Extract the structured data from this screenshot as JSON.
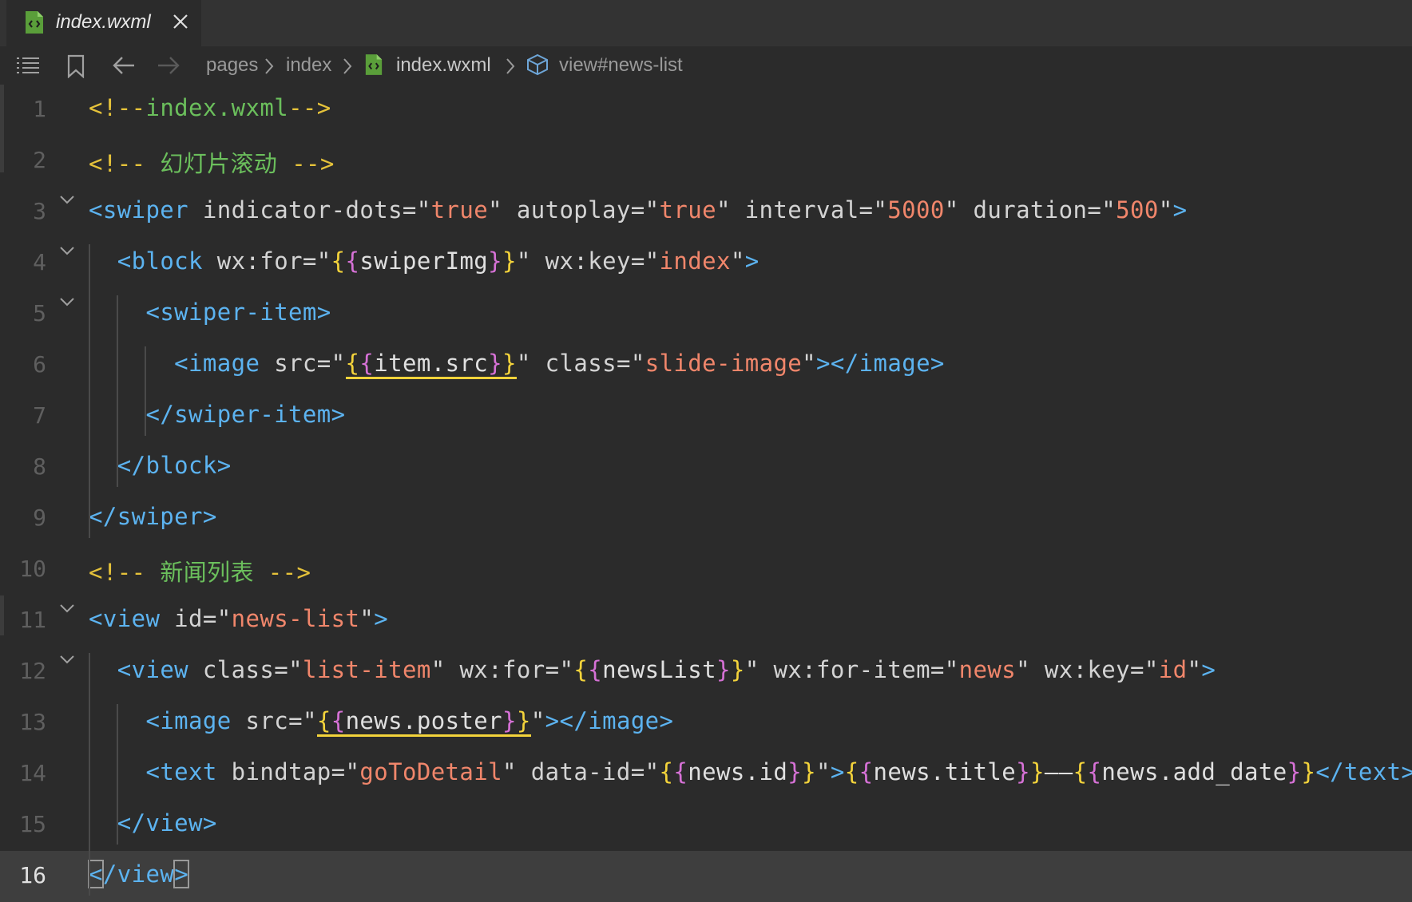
{
  "tab": {
    "label": "index.wxml"
  },
  "breadcrumb": {
    "items": [
      "pages",
      "index",
      "index.wxml",
      "view#news-list"
    ]
  },
  "icons": {
    "tab_file": "wxml-file-icon",
    "close": "close-icon",
    "list": "list-icon",
    "bookmark": "bookmark-icon",
    "back": "arrow-left-icon",
    "forward": "arrow-right-icon",
    "node": "cube-icon"
  },
  "colors": {
    "background": "#2b2b2b",
    "tag": "#5cb3f0",
    "string": "#f0866b",
    "comment": "#e5c23a",
    "comment_text": "#6bbf5c",
    "brace": "#f3d33b",
    "brace_inner": "#d671d6"
  },
  "code": {
    "current_line": 16,
    "lines": [
      {
        "n": "1",
        "fold": false,
        "tokens": [
          [
            "comment",
            "<!--"
          ],
          [
            "ctext",
            "index.wxml"
          ],
          [
            "comment",
            "-->"
          ]
        ]
      },
      {
        "n": "2",
        "fold": false,
        "tokens": [
          [
            "comment",
            "<!-- "
          ],
          [
            "ctext",
            "幻灯片滚动"
          ],
          [
            "comment",
            " -->"
          ]
        ]
      },
      {
        "n": "3",
        "fold": true,
        "tokens": [
          [
            "tag",
            "<swiper"
          ],
          [
            "attr",
            " indicator-dots="
          ],
          [
            "quote",
            "\""
          ],
          [
            "str",
            "true"
          ],
          [
            "quote",
            "\""
          ],
          [
            "attr",
            " autoplay="
          ],
          [
            "quote",
            "\""
          ],
          [
            "str",
            "true"
          ],
          [
            "quote",
            "\""
          ],
          [
            "attr",
            " interval="
          ],
          [
            "quote",
            "\""
          ],
          [
            "str",
            "5000"
          ],
          [
            "quote",
            "\""
          ],
          [
            "attr",
            " duration="
          ],
          [
            "quote",
            "\""
          ],
          [
            "str",
            "500"
          ],
          [
            "quote",
            "\""
          ],
          [
            "tag",
            ">"
          ]
        ]
      },
      {
        "n": "4",
        "fold": true,
        "tokens": [
          [
            "sp",
            "  "
          ],
          [
            "tag",
            "<block"
          ],
          [
            "attr",
            " wx:for="
          ],
          [
            "quote",
            "\""
          ],
          [
            "by",
            "{"
          ],
          [
            "bp",
            "{"
          ],
          [
            "var",
            "swiperImg"
          ],
          [
            "bp",
            "}"
          ],
          [
            "by",
            "}"
          ],
          [
            "quote",
            "\""
          ],
          [
            "attr",
            " wx:key="
          ],
          [
            "quote",
            "\""
          ],
          [
            "str",
            "index"
          ],
          [
            "quote",
            "\""
          ],
          [
            "tag",
            ">"
          ]
        ]
      },
      {
        "n": "5",
        "fold": true,
        "tokens": [
          [
            "sp",
            "    "
          ],
          [
            "tag",
            "<swiper-item>"
          ]
        ]
      },
      {
        "n": "6",
        "fold": false,
        "tokens": [
          [
            "sp",
            "      "
          ],
          [
            "tag",
            "<image"
          ],
          [
            "attr",
            " src="
          ],
          [
            "quote",
            "\""
          ],
          [
            "uby",
            "{"
          ],
          [
            "ubp",
            "{"
          ],
          [
            "uvar",
            "item.src"
          ],
          [
            "ubp",
            "}"
          ],
          [
            "uby",
            "}"
          ],
          [
            "quote",
            "\""
          ],
          [
            "attr",
            " class="
          ],
          [
            "quote",
            "\""
          ],
          [
            "str",
            "slide-image"
          ],
          [
            "quote",
            "\""
          ],
          [
            "tag",
            "></image>"
          ]
        ]
      },
      {
        "n": "7",
        "fold": false,
        "tokens": [
          [
            "sp",
            "    "
          ],
          [
            "tag",
            "</swiper-item>"
          ]
        ]
      },
      {
        "n": "8",
        "fold": false,
        "tokens": [
          [
            "sp",
            "  "
          ],
          [
            "tag",
            "</block>"
          ]
        ]
      },
      {
        "n": "9",
        "fold": false,
        "tokens": [
          [
            "tag",
            "</swiper>"
          ]
        ]
      },
      {
        "n": "10",
        "fold": false,
        "tokens": [
          [
            "comment",
            "<!-- "
          ],
          [
            "ctext",
            "新闻列表"
          ],
          [
            "comment",
            " -->"
          ]
        ]
      },
      {
        "n": "11",
        "fold": true,
        "tokens": [
          [
            "tag",
            "<view"
          ],
          [
            "attr",
            " id="
          ],
          [
            "quote",
            "\""
          ],
          [
            "str",
            "news-list"
          ],
          [
            "quote",
            "\""
          ],
          [
            "tag",
            ">"
          ]
        ]
      },
      {
        "n": "12",
        "fold": true,
        "tokens": [
          [
            "sp",
            "  "
          ],
          [
            "tag",
            "<view"
          ],
          [
            "attr",
            " class="
          ],
          [
            "quote",
            "\""
          ],
          [
            "str",
            "list-item"
          ],
          [
            "quote",
            "\""
          ],
          [
            "attr",
            " wx:for="
          ],
          [
            "quote",
            "\""
          ],
          [
            "by",
            "{"
          ],
          [
            "bp",
            "{"
          ],
          [
            "var",
            "newsList"
          ],
          [
            "bp",
            "}"
          ],
          [
            "by",
            "}"
          ],
          [
            "quote",
            "\""
          ],
          [
            "attr",
            " wx:for-item="
          ],
          [
            "quote",
            "\""
          ],
          [
            "str",
            "news"
          ],
          [
            "quote",
            "\""
          ],
          [
            "attr",
            " wx:key="
          ],
          [
            "quote",
            "\""
          ],
          [
            "str",
            "id"
          ],
          [
            "quote",
            "\""
          ],
          [
            "tag",
            ">"
          ]
        ]
      },
      {
        "n": "13",
        "fold": false,
        "tokens": [
          [
            "sp",
            "    "
          ],
          [
            "tag",
            "<image"
          ],
          [
            "attr",
            " src="
          ],
          [
            "quote",
            "\""
          ],
          [
            "uby",
            "{"
          ],
          [
            "ubp",
            "{"
          ],
          [
            "uvar",
            "news.poster"
          ],
          [
            "ubp",
            "}"
          ],
          [
            "uby",
            "}"
          ],
          [
            "quote",
            "\""
          ],
          [
            "tag",
            "></image>"
          ]
        ]
      },
      {
        "n": "14",
        "fold": false,
        "tokens": [
          [
            "sp",
            "    "
          ],
          [
            "tag",
            "<text"
          ],
          [
            "attr",
            " bindtap="
          ],
          [
            "quote",
            "\""
          ],
          [
            "str",
            "goToDetail"
          ],
          [
            "quote",
            "\""
          ],
          [
            "attr",
            " data-id="
          ],
          [
            "quote",
            "\""
          ],
          [
            "by",
            "{"
          ],
          [
            "bp",
            "{"
          ],
          [
            "var",
            "news.id"
          ],
          [
            "bp",
            "}"
          ],
          [
            "by",
            "}"
          ],
          [
            "quote",
            "\""
          ],
          [
            "tag",
            ">"
          ],
          [
            "by",
            "{"
          ],
          [
            "bp",
            "{"
          ],
          [
            "var",
            "news.title"
          ],
          [
            "bp",
            "}"
          ],
          [
            "by",
            "}"
          ],
          [
            "var",
            "——"
          ],
          [
            "by",
            "{"
          ],
          [
            "bp",
            "{"
          ],
          [
            "var",
            "news.add_date"
          ],
          [
            "bp",
            "}"
          ],
          [
            "by",
            "}"
          ],
          [
            "tag",
            "</text>"
          ]
        ]
      },
      {
        "n": "15",
        "fold": false,
        "tokens": [
          [
            "sp",
            "  "
          ],
          [
            "tag",
            "</view>"
          ]
        ]
      },
      {
        "n": "16",
        "fold": false,
        "tokens": [
          [
            "cursor",
            "<"
          ],
          [
            "tag",
            "/view"
          ],
          [
            "cursor",
            ">"
          ]
        ]
      }
    ]
  }
}
